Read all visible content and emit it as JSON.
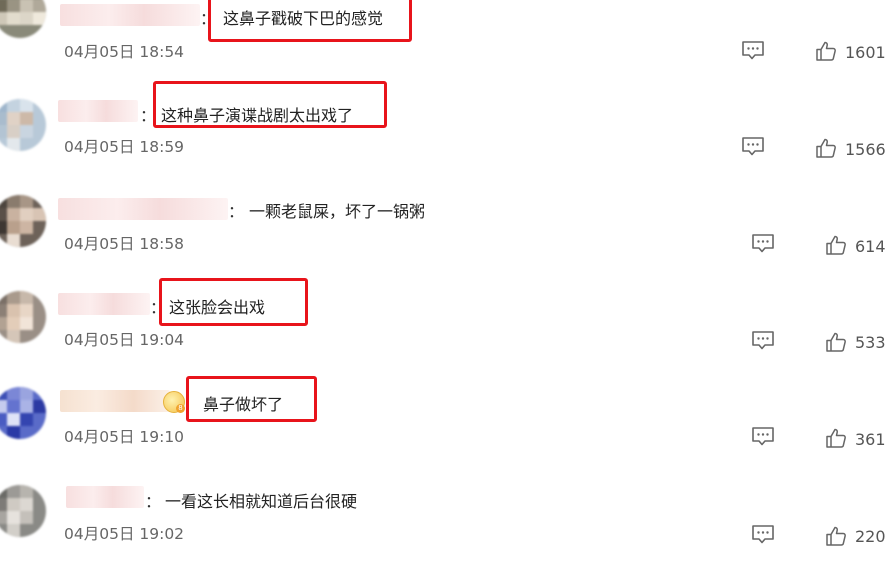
{
  "comments": [
    {
      "text": "这鼻子戳破下巴的感觉",
      "date": "04月05日 18:54",
      "likes": "1601"
    },
    {
      "text": "这种鼻子演谍战剧太出戏了",
      "date": "04月05日 18:59",
      "likes": "1566"
    },
    {
      "text": "一颗老鼠屎，坏了一锅粥",
      "date": "04月05日 18:58",
      "likes": "614"
    },
    {
      "text": "这张脸会出戏",
      "date": "04月05日 19:04",
      "likes": "533"
    },
    {
      "text": "鼻子做坏了",
      "date": "04月05日 19:10",
      "likes": "361"
    },
    {
      "text": "一看这长相就知道后台很硬",
      "date": "04月05日 19:02",
      "likes": "220"
    }
  ],
  "punctuation": {
    "colon": "："
  },
  "icons": {
    "reply": "comment-bubble-icon",
    "like": "thumbs-up-icon",
    "badge": "vip-badge-icon"
  },
  "colors": {
    "highlight": "#e8141b",
    "date": "#666666",
    "text": "#222222",
    "icon": "#666666"
  }
}
